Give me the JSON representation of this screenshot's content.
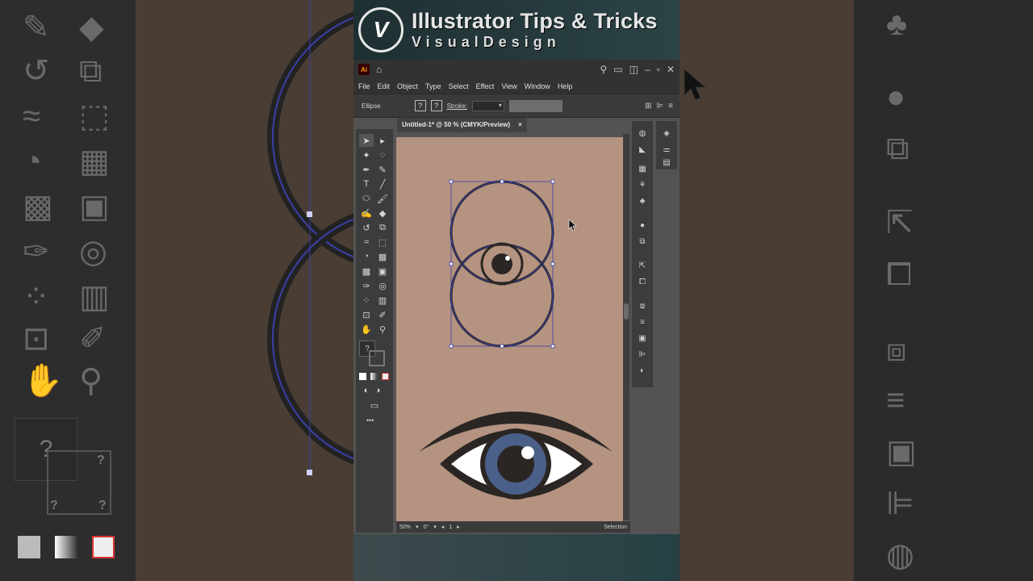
{
  "banner": {
    "title": "Illustrator Tips & Tricks",
    "subtitle": "VisualDesign",
    "logo_icon": "vd-logo-icon"
  },
  "app": {
    "app_icon_label": "Ai",
    "menu": [
      "File",
      "Edit",
      "Object",
      "Type",
      "Select",
      "Effect",
      "View",
      "Window",
      "Help"
    ],
    "control": {
      "shape_label": "Ellipse",
      "stroke_label": "Stroke:",
      "fill_box": "?",
      "stroke_box": "?"
    },
    "document_tab": {
      "title": "Untitled-1* @ 50 % (CMYK/Preview)",
      "close": "×"
    },
    "fill_stroke_swatch": "?",
    "more_tools": "•••",
    "status": {
      "zoom": "50%",
      "rotation": "0°",
      "artboard": "1",
      "tool": "Selection"
    },
    "colors": {
      "artboard": "#b49381",
      "eye_iris": "#4a6088",
      "eye_dark": "#2b2624",
      "selection": "#3b3fa8"
    }
  },
  "background": {
    "left_question": "?",
    "left_question_small_a": "?",
    "left_question_small_b": "?",
    "left_question_small_c": "?"
  }
}
